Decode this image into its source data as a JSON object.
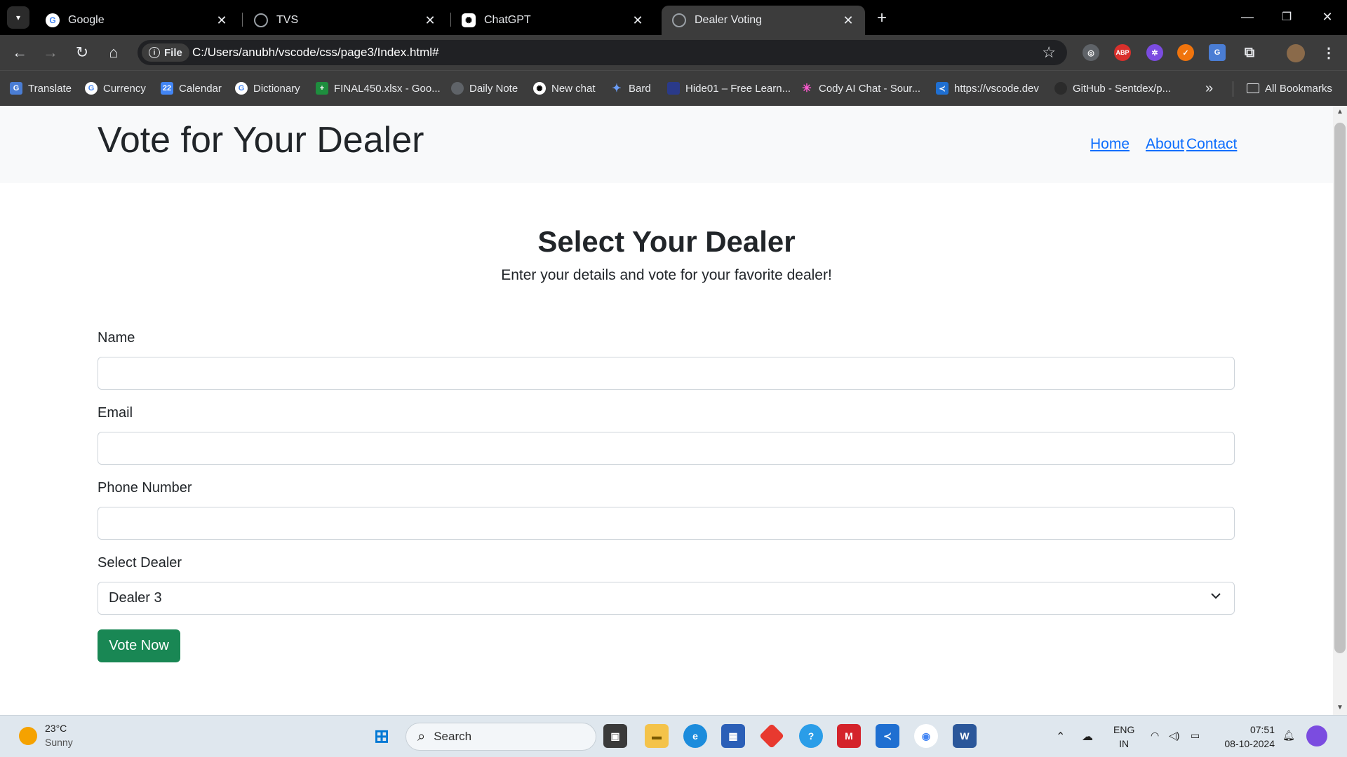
{
  "browser": {
    "tabs": [
      {
        "title": "Google",
        "icon": "google-icon"
      },
      {
        "title": "TVS",
        "icon": "globe-icon"
      },
      {
        "title": "ChatGPT",
        "icon": "chatgpt-icon"
      },
      {
        "title": "Dealer Voting",
        "icon": "globe-icon",
        "active": true
      }
    ],
    "address": {
      "chip": "File",
      "url": "C:/Users/anubh/vscode/css/page3/Index.html#"
    },
    "bookmarks": [
      "Translate",
      "Currency",
      "Calendar",
      "Dictionary",
      "FINAL450.xlsx - Goo...",
      "Daily Note",
      "New chat",
      "Bard",
      "Hide01 – Free Learn...",
      "Cody AI Chat - Sour...",
      "https://vscode.dev",
      "GitHub - Sentdex/p..."
    ],
    "all_bookmarks": "All Bookmarks",
    "more_bookmarks": "»"
  },
  "page": {
    "site_title": "Vote for Your Dealer",
    "nav": [
      "Home",
      "About",
      "Contact"
    ],
    "hero_title": "Select Your Dealer",
    "hero_subtitle": "Enter your details and vote for your favorite dealer!",
    "form": {
      "name_label": "Name",
      "name_value": "",
      "email_label": "Email",
      "email_value": "",
      "phone_label": "Phone Number",
      "phone_value": "",
      "dealer_label": "Select Dealer",
      "dealer_selected": "Dealer 3",
      "submit_label": "Vote Now"
    },
    "colors": {
      "link": "#0d6efd",
      "button": "#198754"
    }
  },
  "taskbar": {
    "weather_temp": "23°C",
    "weather_desc": "Sunny",
    "search_placeholder": "Search",
    "lang_1": "ENG",
    "lang_2": "IN",
    "time": "07:51",
    "date": "08-10-2024"
  }
}
